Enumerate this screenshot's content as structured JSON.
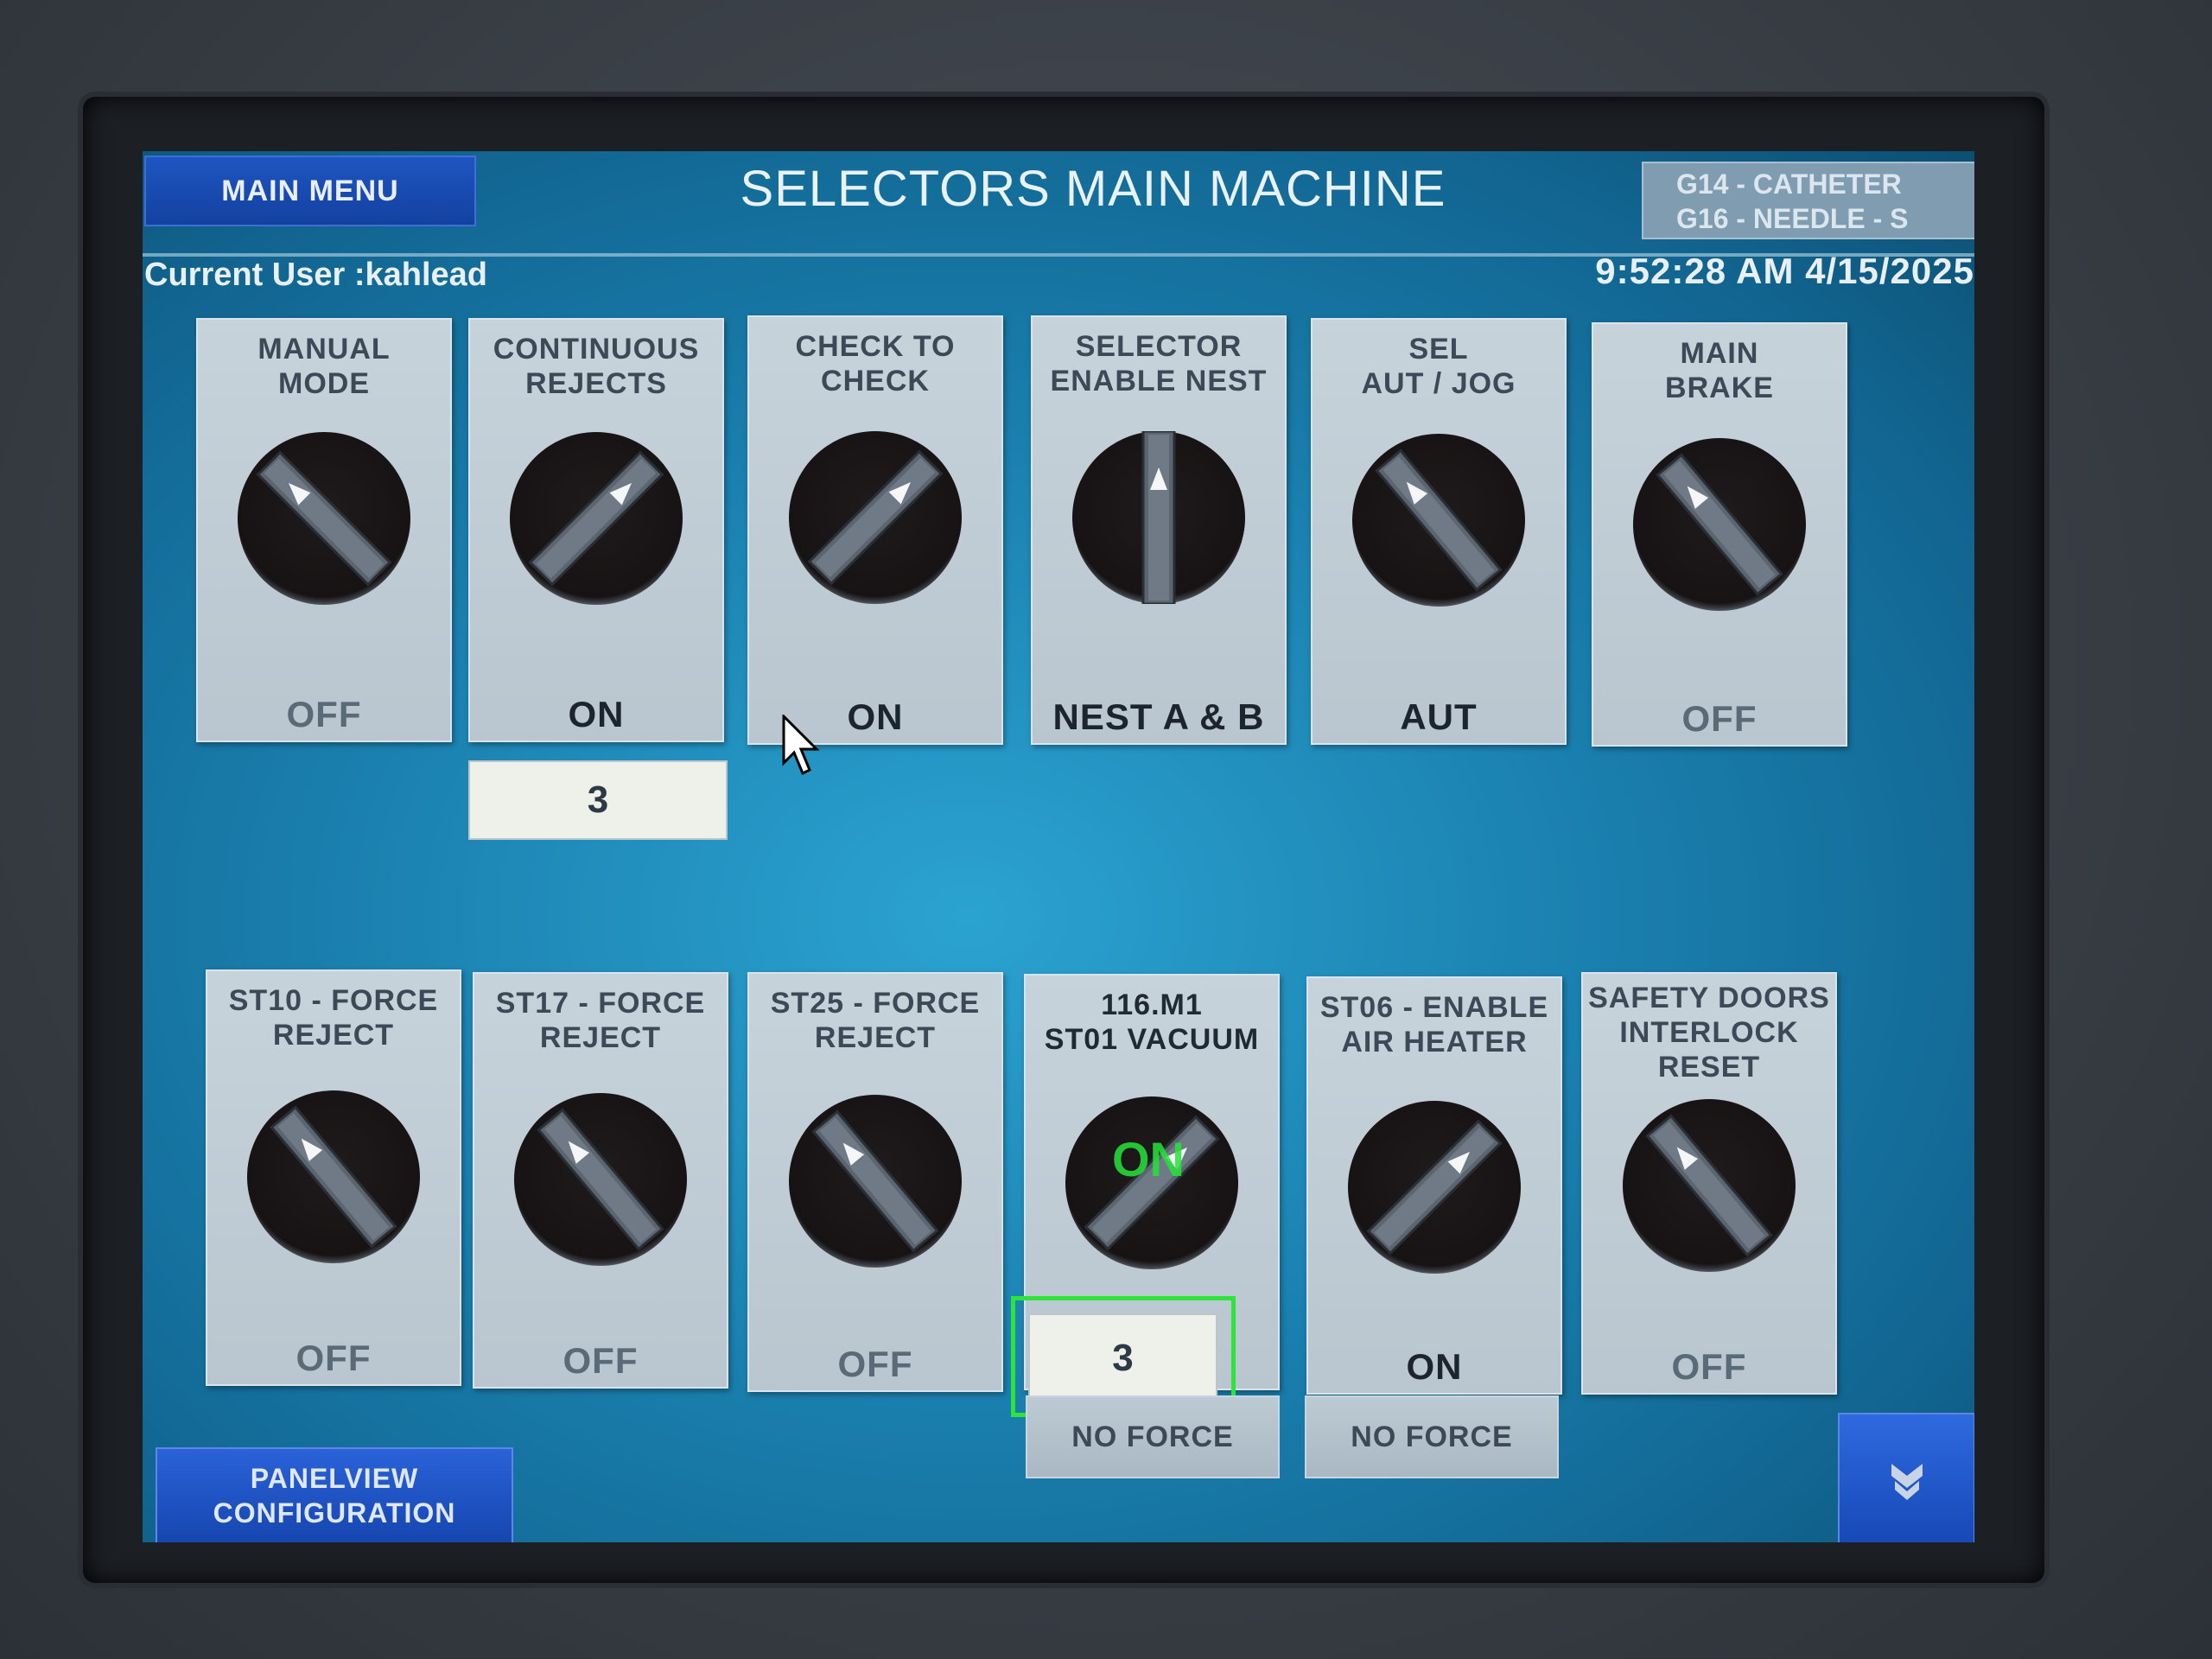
{
  "header": {
    "main_menu_label": "MAIN MENU",
    "title": "SELECTORS MAIN MACHINE",
    "product_line1": "G14 - CATHETER",
    "product_line2": "G16 - NEEDLE - S",
    "current_user": "Current User :kahlead",
    "datetime": "9:52:28 AM 4/15/2025"
  },
  "selectors_top": [
    {
      "label": "MANUAL\nMODE",
      "state": "OFF"
    },
    {
      "label": "CONTINUOUS\nREJECTS",
      "state": "ON",
      "count": "3"
    },
    {
      "label": "CHECK TO\nCHECK",
      "state": "ON"
    },
    {
      "label": "SELECTOR\nENABLE NEST",
      "state": "NEST A & B"
    },
    {
      "label": "SEL\nAUT / JOG",
      "state": "AUT"
    },
    {
      "label": "MAIN\nBRAKE",
      "state": "OFF"
    }
  ],
  "selectors_bottom": [
    {
      "label": "ST10 - FORCE\nREJECT",
      "state": "OFF"
    },
    {
      "label": "ST17 - FORCE\nREJECT",
      "state": "OFF"
    },
    {
      "label": "ST25 - FORCE\nREJECT",
      "state": "OFF"
    },
    {
      "label": "116.M1\nST01 VACUUM",
      "state": "",
      "overlay": "ON",
      "count": "3",
      "force": "NO FORCE"
    },
    {
      "label": "ST06 - ENABLE\nAIR HEATER",
      "state": "ON",
      "force": "NO FORCE"
    },
    {
      "label": "SAFETY DOORS\nINTERLOCK\nRESET",
      "state": "OFF"
    }
  ],
  "footer": {
    "panelview_line1": "PANELVIEW",
    "panelview_line2": "CONFIGURATION",
    "down_icon": "chevron-down-icon"
  },
  "colors": {
    "screen_bg": "#1a7fae",
    "button_blue": "#1f55c2",
    "tile_grey": "#c7d3db",
    "highlight_green": "#2ee33a"
  }
}
